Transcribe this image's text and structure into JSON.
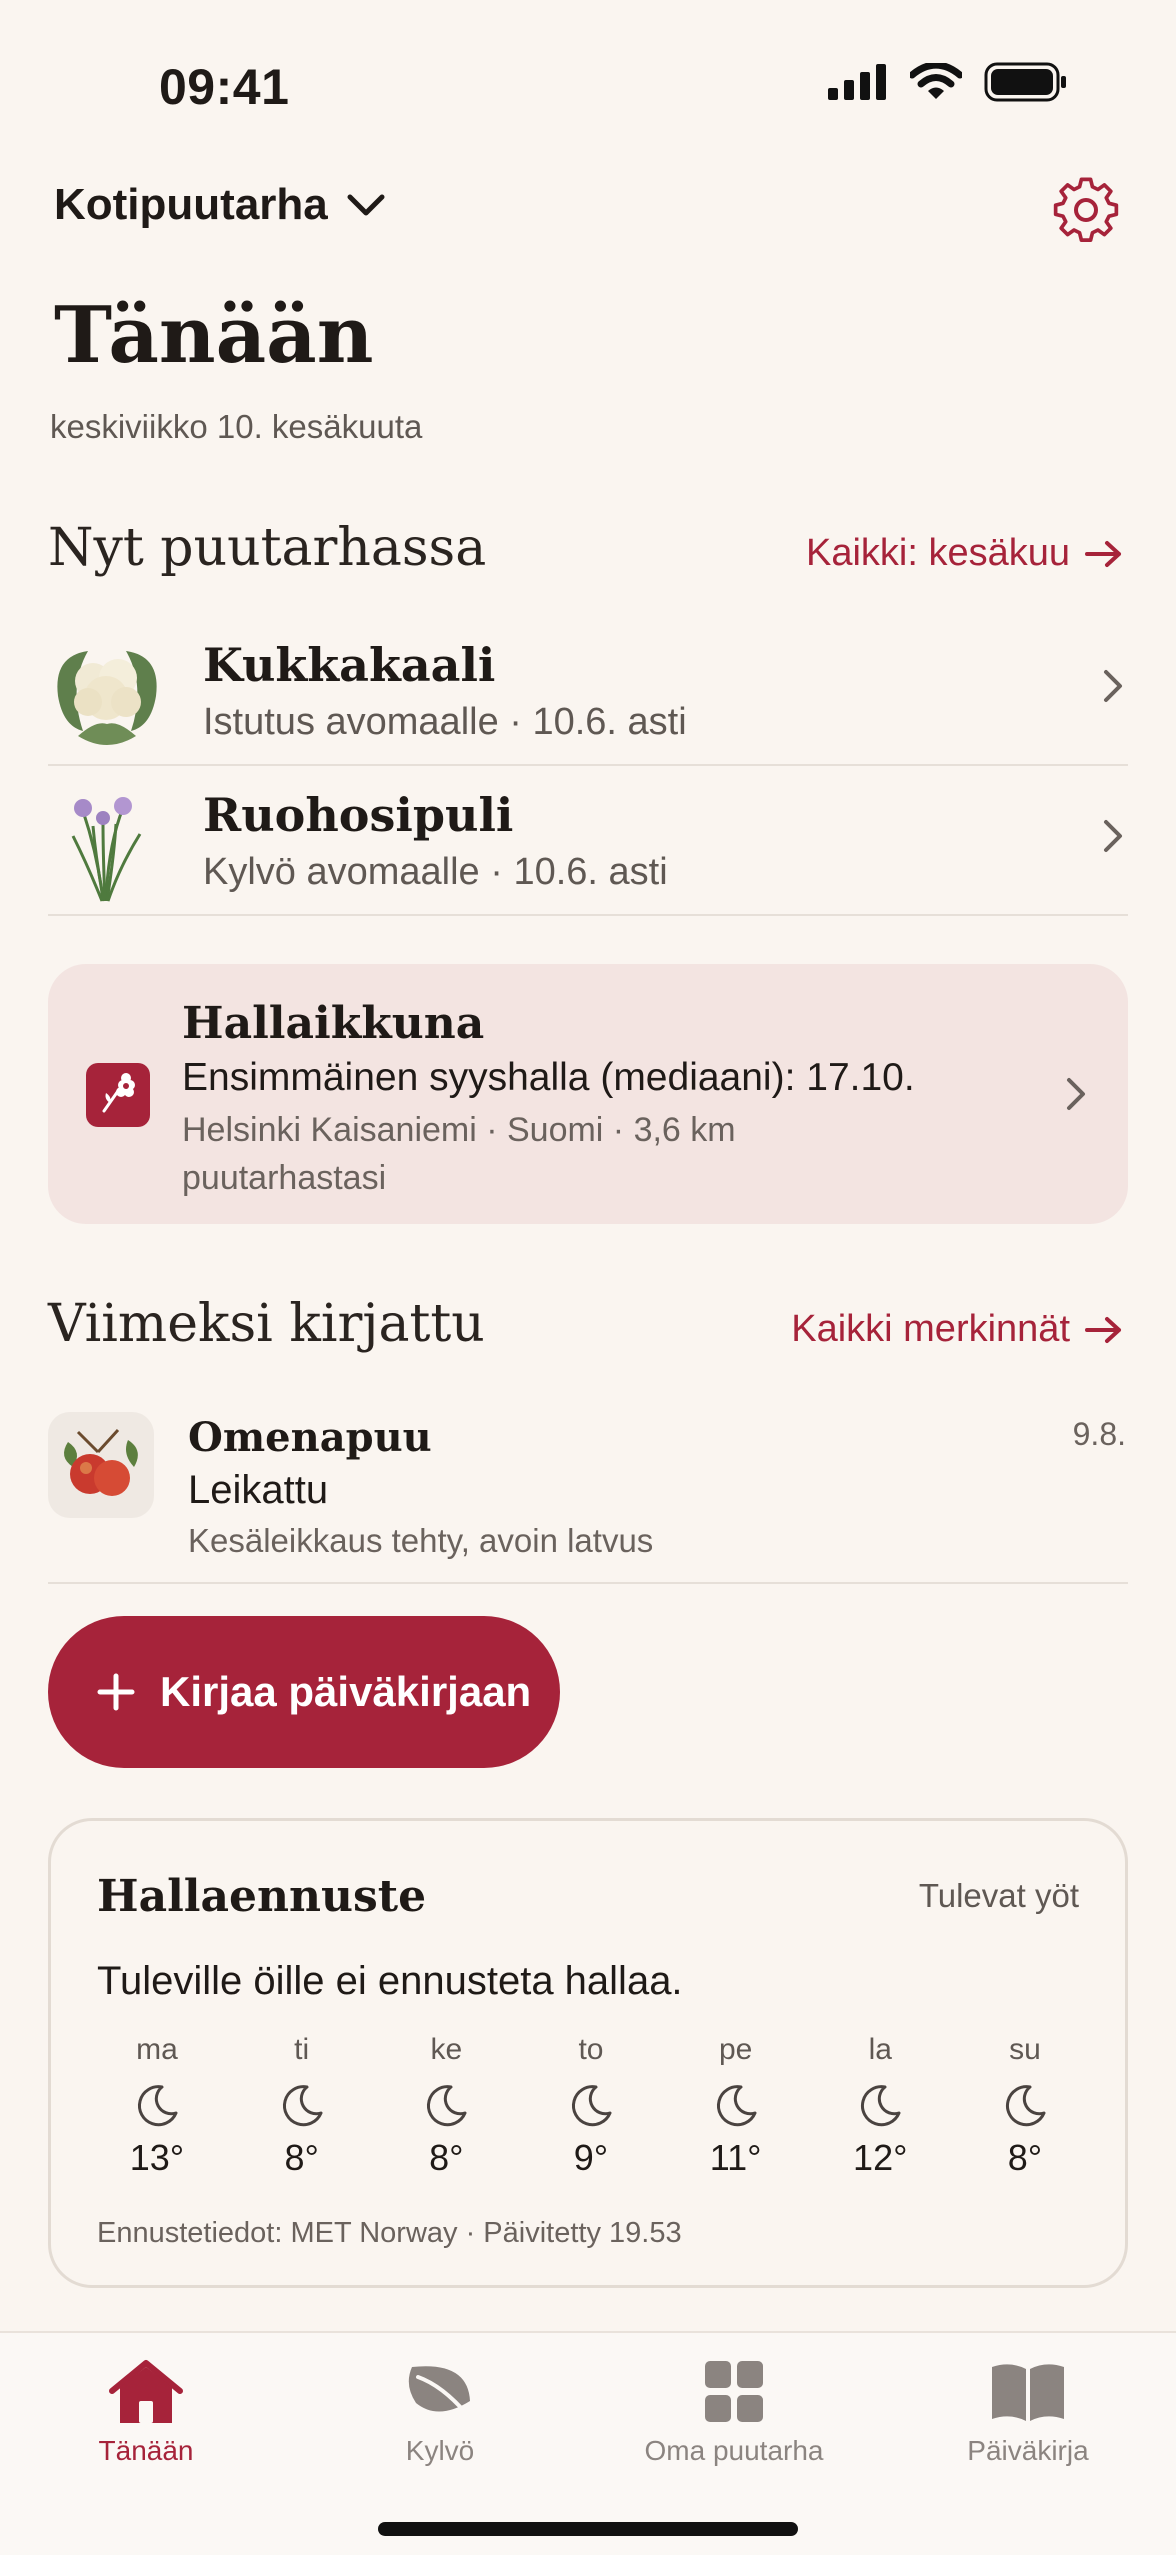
{
  "status": {
    "time": "09:41"
  },
  "header": {
    "garden_name": "Kotipuutarha",
    "settings_icon": "gear-icon"
  },
  "page": {
    "title": "Tänään",
    "date": "keskiviikko 10. kesäkuuta"
  },
  "now_section": {
    "title": "Nyt puutarhassa",
    "link": "Kaikki: kesäkuu",
    "items": [
      {
        "name": "Kukkakaali",
        "subtitle": "Istutus avomaalle · 10.6. asti",
        "icon": "cauliflower-image"
      },
      {
        "name": "Ruohosipuli",
        "subtitle": "Kylvö avomaalle · 10.6. asti",
        "icon": "chives-image"
      }
    ]
  },
  "frost_window": {
    "title": "Hallaikkuna",
    "line": "Ensimmäinen syyshalla (mediaani): 17.10.",
    "meta": "Helsinki Kaisaniemi · Suomi · 3,6 km puutarhastasi",
    "accent": "#a6233a",
    "background": "#f3e4e1"
  },
  "recent_section": {
    "title": "Viimeksi kirjattu",
    "link": "Kaikki merkinnät",
    "entry": {
      "plant": "Omenapuu",
      "action": "Leikattu",
      "note": "Kesäleikkaus tehty, avoin latvus",
      "date": "9.8."
    }
  },
  "log_button": {
    "label": "Kirjaa päiväkirjaan",
    "icon": "plus-icon"
  },
  "forecast": {
    "title": "Hallaennuste",
    "tag": "Tulevat yöt",
    "message": "Tuleville öille ei ennusteta hallaa.",
    "days": [
      {
        "day": "ma",
        "temp": "13°"
      },
      {
        "day": "ti",
        "temp": "8°"
      },
      {
        "day": "ke",
        "temp": "8°"
      },
      {
        "day": "to",
        "temp": "9°"
      },
      {
        "day": "pe",
        "temp": "11°"
      },
      {
        "day": "la",
        "temp": "12°"
      },
      {
        "day": "su",
        "temp": "8°"
      }
    ],
    "source": "Ennustetiedot: MET Norway · Päivitetty 19.53"
  },
  "tabs": [
    {
      "label": "Tänään",
      "icon": "home-icon",
      "active": true
    },
    {
      "label": "Kylvö",
      "icon": "leaf-icon",
      "active": false
    },
    {
      "label": "Oma puutarha",
      "icon": "grid-icon",
      "active": false
    },
    {
      "label": "Päiväkirja",
      "icon": "book-icon",
      "active": false
    }
  ],
  "colors": {
    "accent": "#a6233a",
    "background": "#faf5f0",
    "muted_text": "#5f5853"
  }
}
